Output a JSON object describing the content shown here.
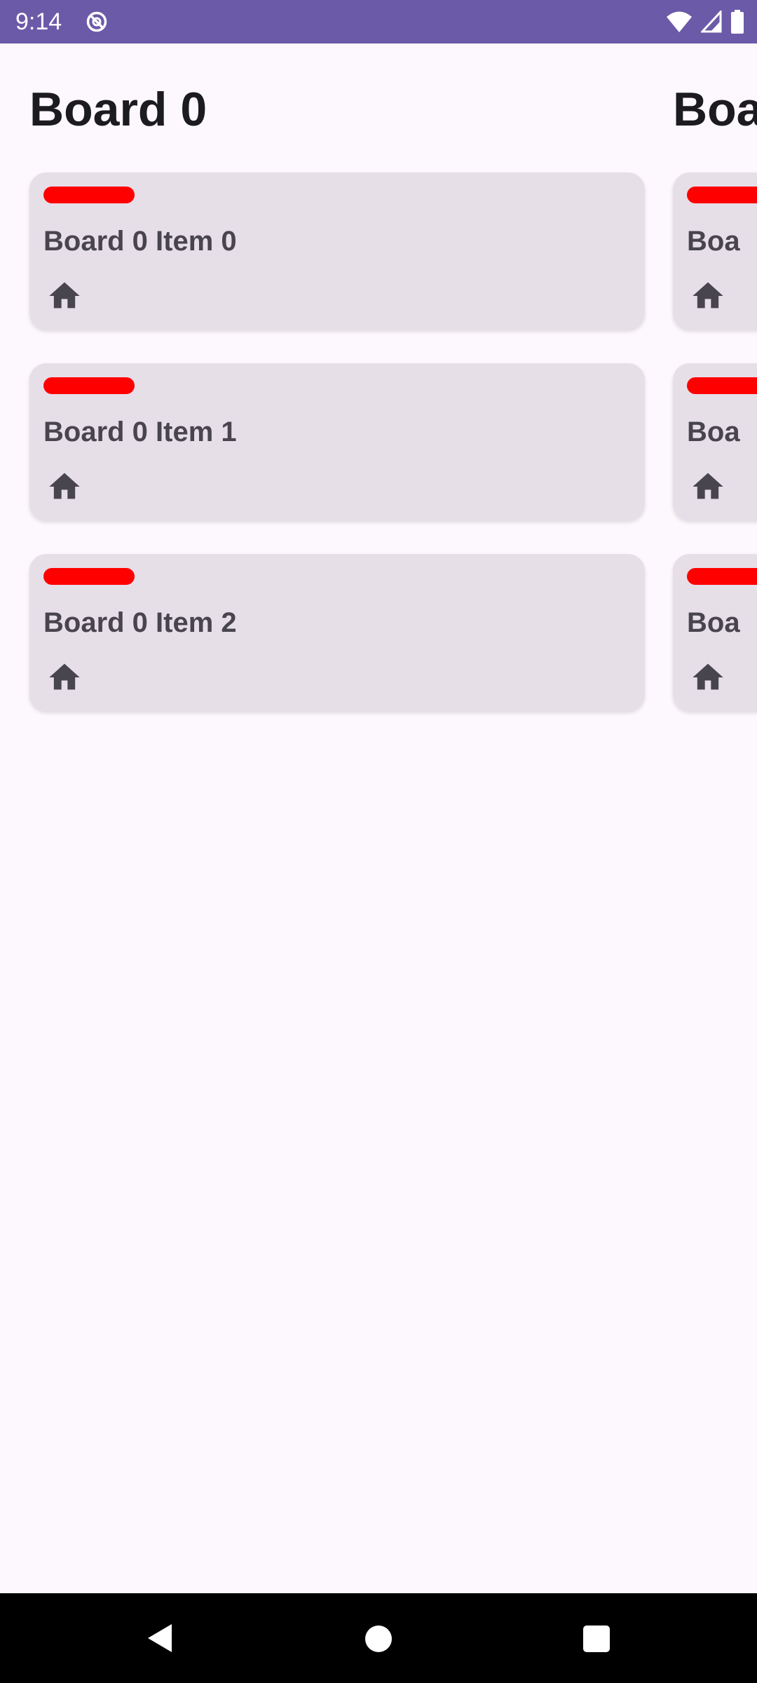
{
  "status_bar": {
    "time": "9:14",
    "icons": [
      "do-not-disturb-icon",
      "wifi-icon",
      "cell-signal-icon",
      "battery-icon"
    ]
  },
  "boards": [
    {
      "title": "Board 0",
      "items": [
        {
          "title": "Board 0 Item 0",
          "tag_color": "#ff0000",
          "icon": "home-icon"
        },
        {
          "title": "Board 0 Item 1",
          "tag_color": "#ff0000",
          "icon": "home-icon"
        },
        {
          "title": "Board 0 Item 2",
          "tag_color": "#ff0000",
          "icon": "home-icon"
        }
      ]
    },
    {
      "title": "Boa",
      "items": [
        {
          "title": "Boa",
          "tag_color": "#ff0000",
          "icon": "home-icon"
        },
        {
          "title": "Boa",
          "tag_color": "#ff0000",
          "icon": "home-icon"
        },
        {
          "title": "Boa",
          "tag_color": "#ff0000",
          "icon": "home-icon"
        }
      ]
    }
  ],
  "nav_bar": {
    "icons": [
      "back-icon",
      "home-icon",
      "recents-icon"
    ]
  },
  "colors": {
    "status_bar": "#6b5aa8",
    "background": "#fdf8fd",
    "card": "#e7dfe8",
    "tag": "#ff0000",
    "text": "#49454f"
  }
}
